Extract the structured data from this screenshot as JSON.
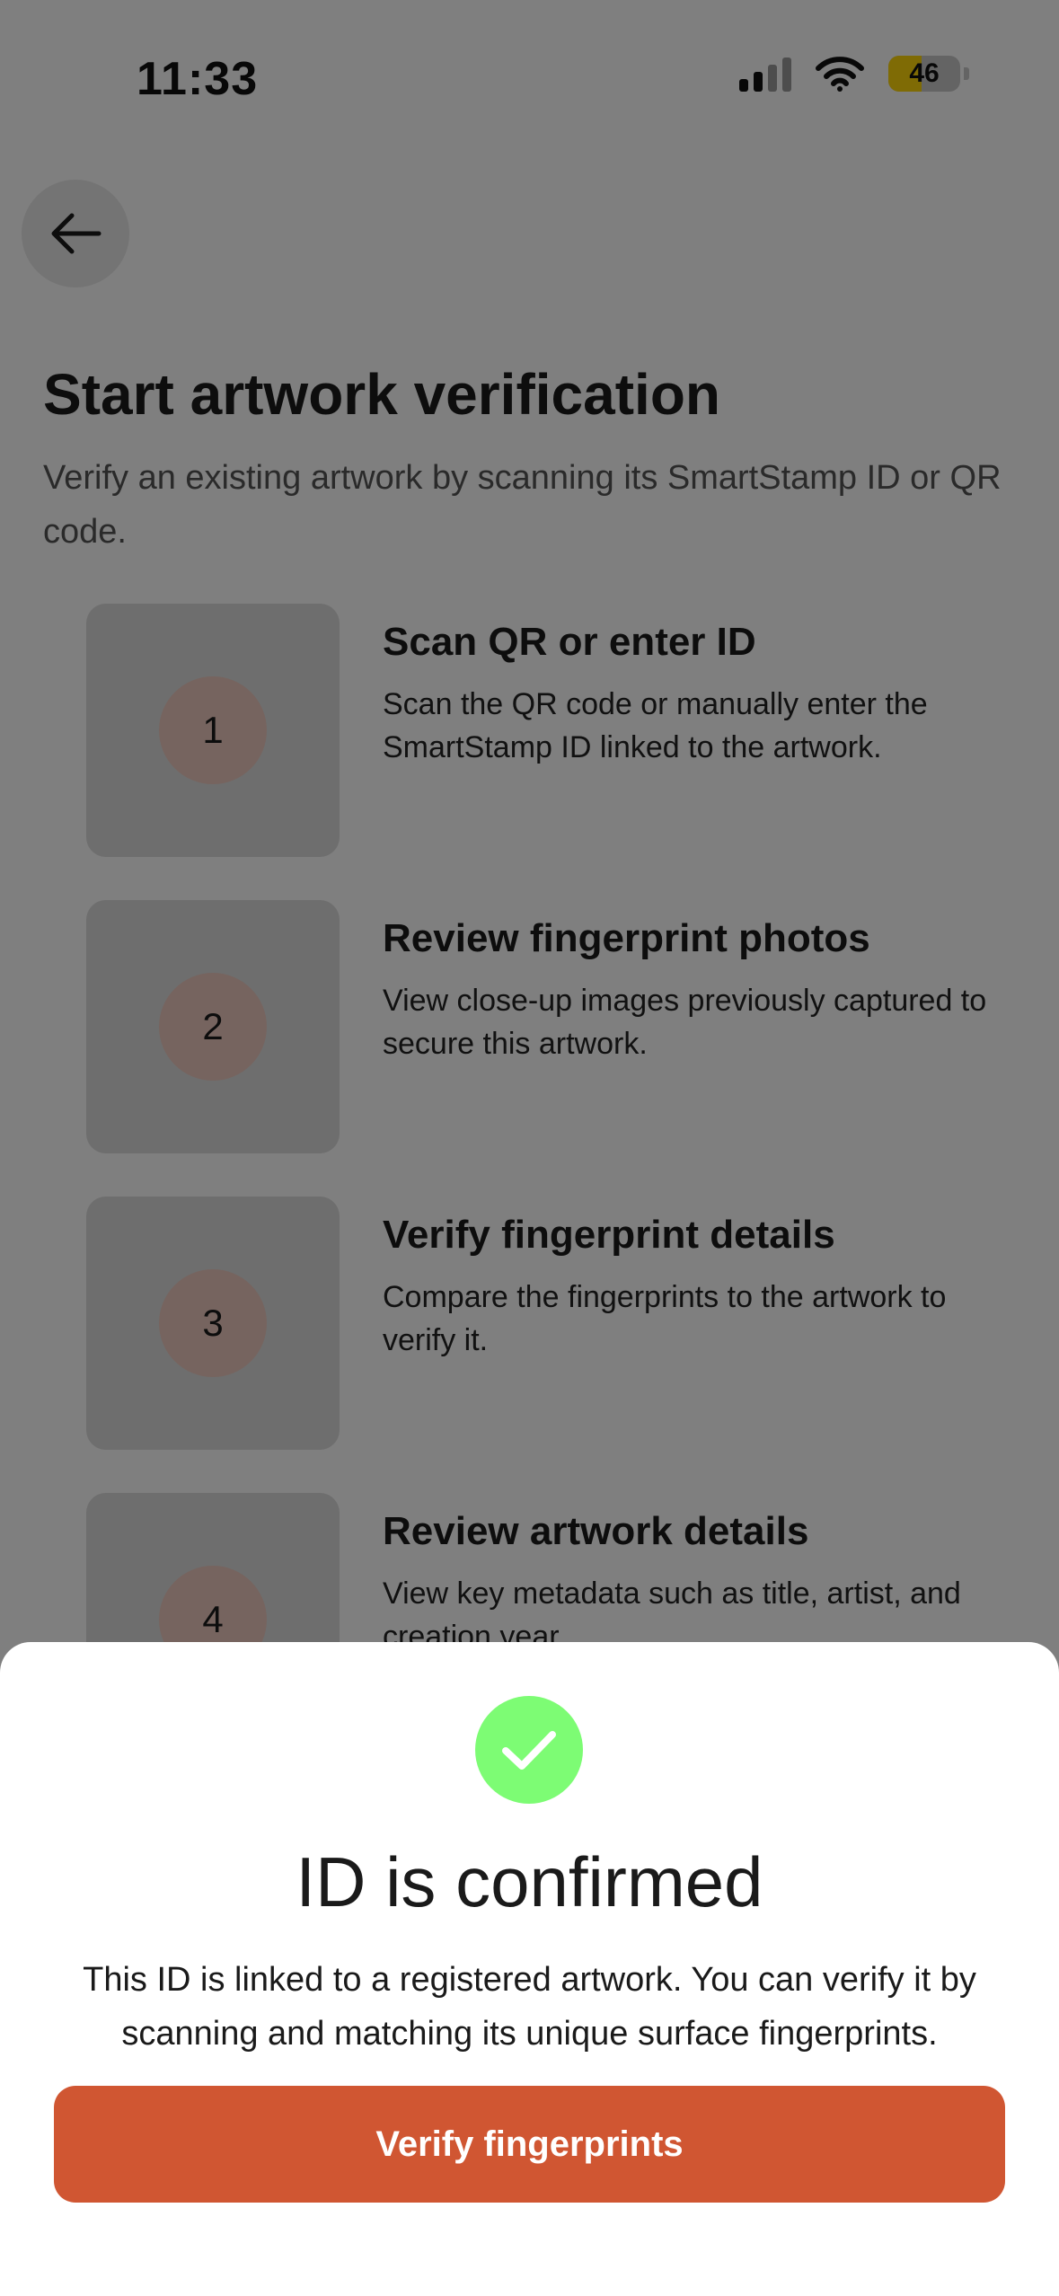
{
  "status_bar": {
    "time": "11:33",
    "battery_percent": 46,
    "battery_label": "46",
    "signal_bars_active": 2,
    "signal_bars_total": 4
  },
  "header": {
    "back_icon": "arrow-left-icon"
  },
  "page": {
    "title": "Start artwork verification",
    "subtitle": "Verify an existing artwork by scanning its SmartStamp ID or QR code."
  },
  "steps": [
    {
      "number": "1",
      "title": "Scan QR or enter ID",
      "description": "Scan the QR code or manually enter the SmartStamp ID linked to the artwork."
    },
    {
      "number": "2",
      "title": "Review fingerprint photos",
      "description": "View close-up images previously captured to secure this artwork."
    },
    {
      "number": "3",
      "title": "Verify fingerprint details",
      "description": "Compare the fingerprints to the artwork to verify it."
    },
    {
      "number": "4",
      "title": "Review artwork details",
      "description": "View key metadata such as title, artist, and creation year."
    }
  ],
  "sheet": {
    "icon": "checkmark-icon",
    "title": "ID is confirmed",
    "description": "This ID is linked to a registered artwork. You can verify it by scanning and matching its unique surface fingerprints.",
    "button_label": "Verify fingerprints"
  },
  "colors": {
    "accent": "#d05632",
    "success": "#7dfc74",
    "step_circle": "#ecc9be",
    "battery": "#ffd60a",
    "overlay": "rgba(0,0,0,0.5)"
  }
}
